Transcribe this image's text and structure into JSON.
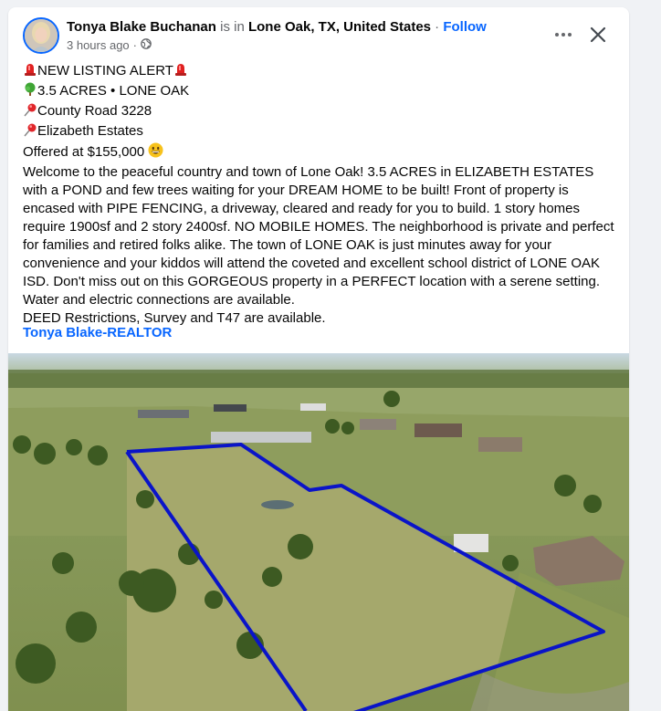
{
  "post": {
    "author": "Tonya Blake Buchanan",
    "is_in": "is in",
    "location": "Lone Oak, TX, United States",
    "separator": " · ",
    "follow": "Follow",
    "timestamp": "3 hours ago",
    "meta_separator": "·",
    "privacy_icon": "globe-icon",
    "lines": {
      "alert": "NEW LISTING ALERT",
      "acres": "3.5 ACRES • LONE OAK",
      "road": "County Road 3228",
      "estates": "Elizabeth Estates",
      "offered": "Offered at $155,000"
    },
    "description": "Welcome to the peaceful country and town of Lone Oak!  3.5 ACRES in ELIZABETH ESTATES with a POND and few trees waiting for your DREAM HOME to be built!  Front of property is encased with PIPE FENCING, a driveway, cleared and ready for you to build. 1 story homes require 1900sf and 2 story 2400sf.  NO MOBILE HOMES.  The neighborhood is private and perfect for families and retired folks alike. The town of LONE OAK is just minutes away for your convenience and your kiddos will attend the coveted and excellent school district of LONE OAK ISD. Don't miss out on this GORGEOUS property in a PERFECT location with a serene setting. Water and electric connections are available.",
    "deed": "DEED Restrictions, Survey and T47 are available.",
    "signature": "Tonya Blake-REALTOR"
  },
  "colors": {
    "accent": "#0866ff",
    "muted": "#65676b",
    "boundary": "#0a14c8"
  }
}
